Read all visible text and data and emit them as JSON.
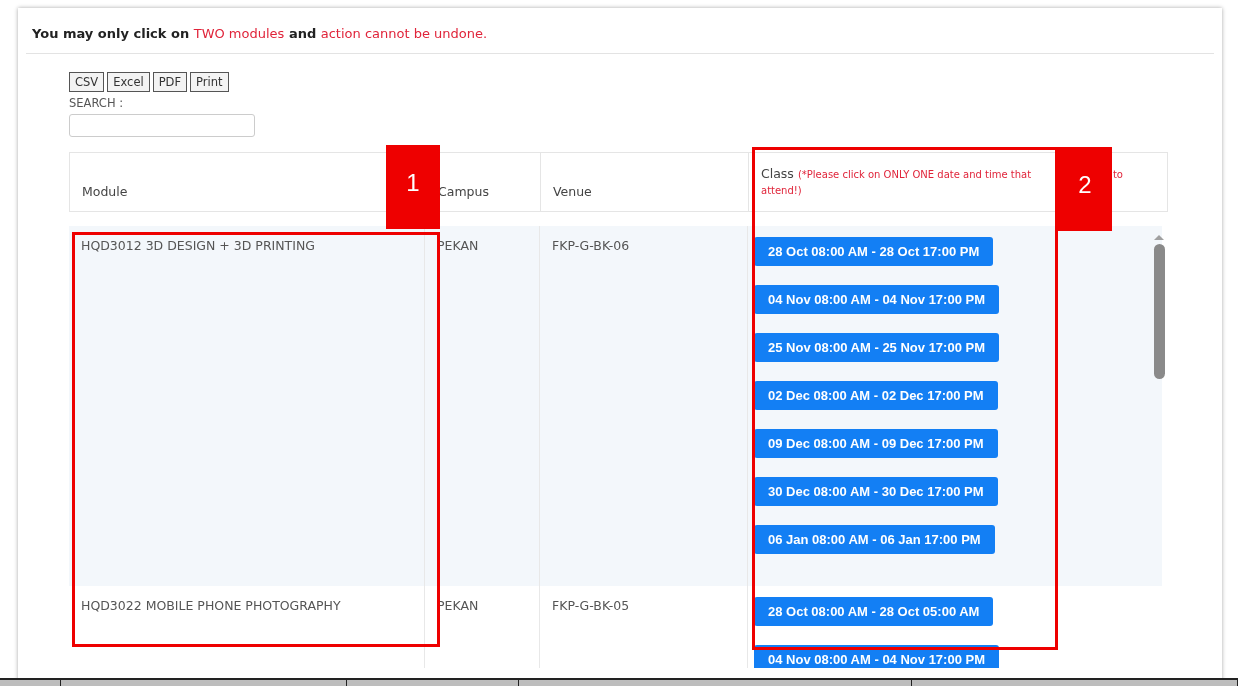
{
  "notice": [
    {
      "text": "You may only click on ",
      "highlight": false
    },
    {
      "text": "TWO modules",
      "highlight": true
    },
    {
      "text": " and ",
      "highlight": false
    },
    {
      "text": "action cannot be undone.",
      "highlight": true
    }
  ],
  "export_buttons": [
    "CSV",
    "Excel",
    "PDF",
    "Print"
  ],
  "search": {
    "label": "SEARCH :"
  },
  "table": {
    "columns": [
      "Module",
      "Campus",
      "Venue",
      "Class"
    ],
    "class_note": [
      "(*Please click on ONLY ONE date and time that",
      "to",
      "attend!)"
    ],
    "rows": [
      {
        "module": "HQD3012 3D DESIGN + 3D PRINTING",
        "campus": "PEKAN",
        "venue": "FKP-G-BK-06",
        "classes": [
          "28 Oct 08:00 AM - 28 Oct 17:00 PM",
          "04 Nov 08:00 AM - 04 Nov 17:00 PM",
          "25 Nov 08:00 AM - 25 Nov 17:00 PM",
          "02 Dec 08:00 AM - 02 Dec 17:00 PM",
          "09 Dec 08:00 AM - 09 Dec 17:00 PM",
          "30 Dec 08:00 AM - 30 Dec 17:00 PM",
          "06 Jan 08:00 AM - 06 Jan 17:00 PM"
        ]
      },
      {
        "module": "HQD3022 MOBILE PHONE PHOTOGRAPHY",
        "campus": "PEKAN",
        "venue": "FKP-G-BK-05",
        "classes": [
          "28 Oct 08:00 AM - 28 Oct 05:00 AM",
          "04 Nov 08:00 AM - 04 Nov 17:00 PM"
        ]
      }
    ]
  },
  "callouts": [
    {
      "label": "1"
    },
    {
      "label": "2"
    }
  ]
}
